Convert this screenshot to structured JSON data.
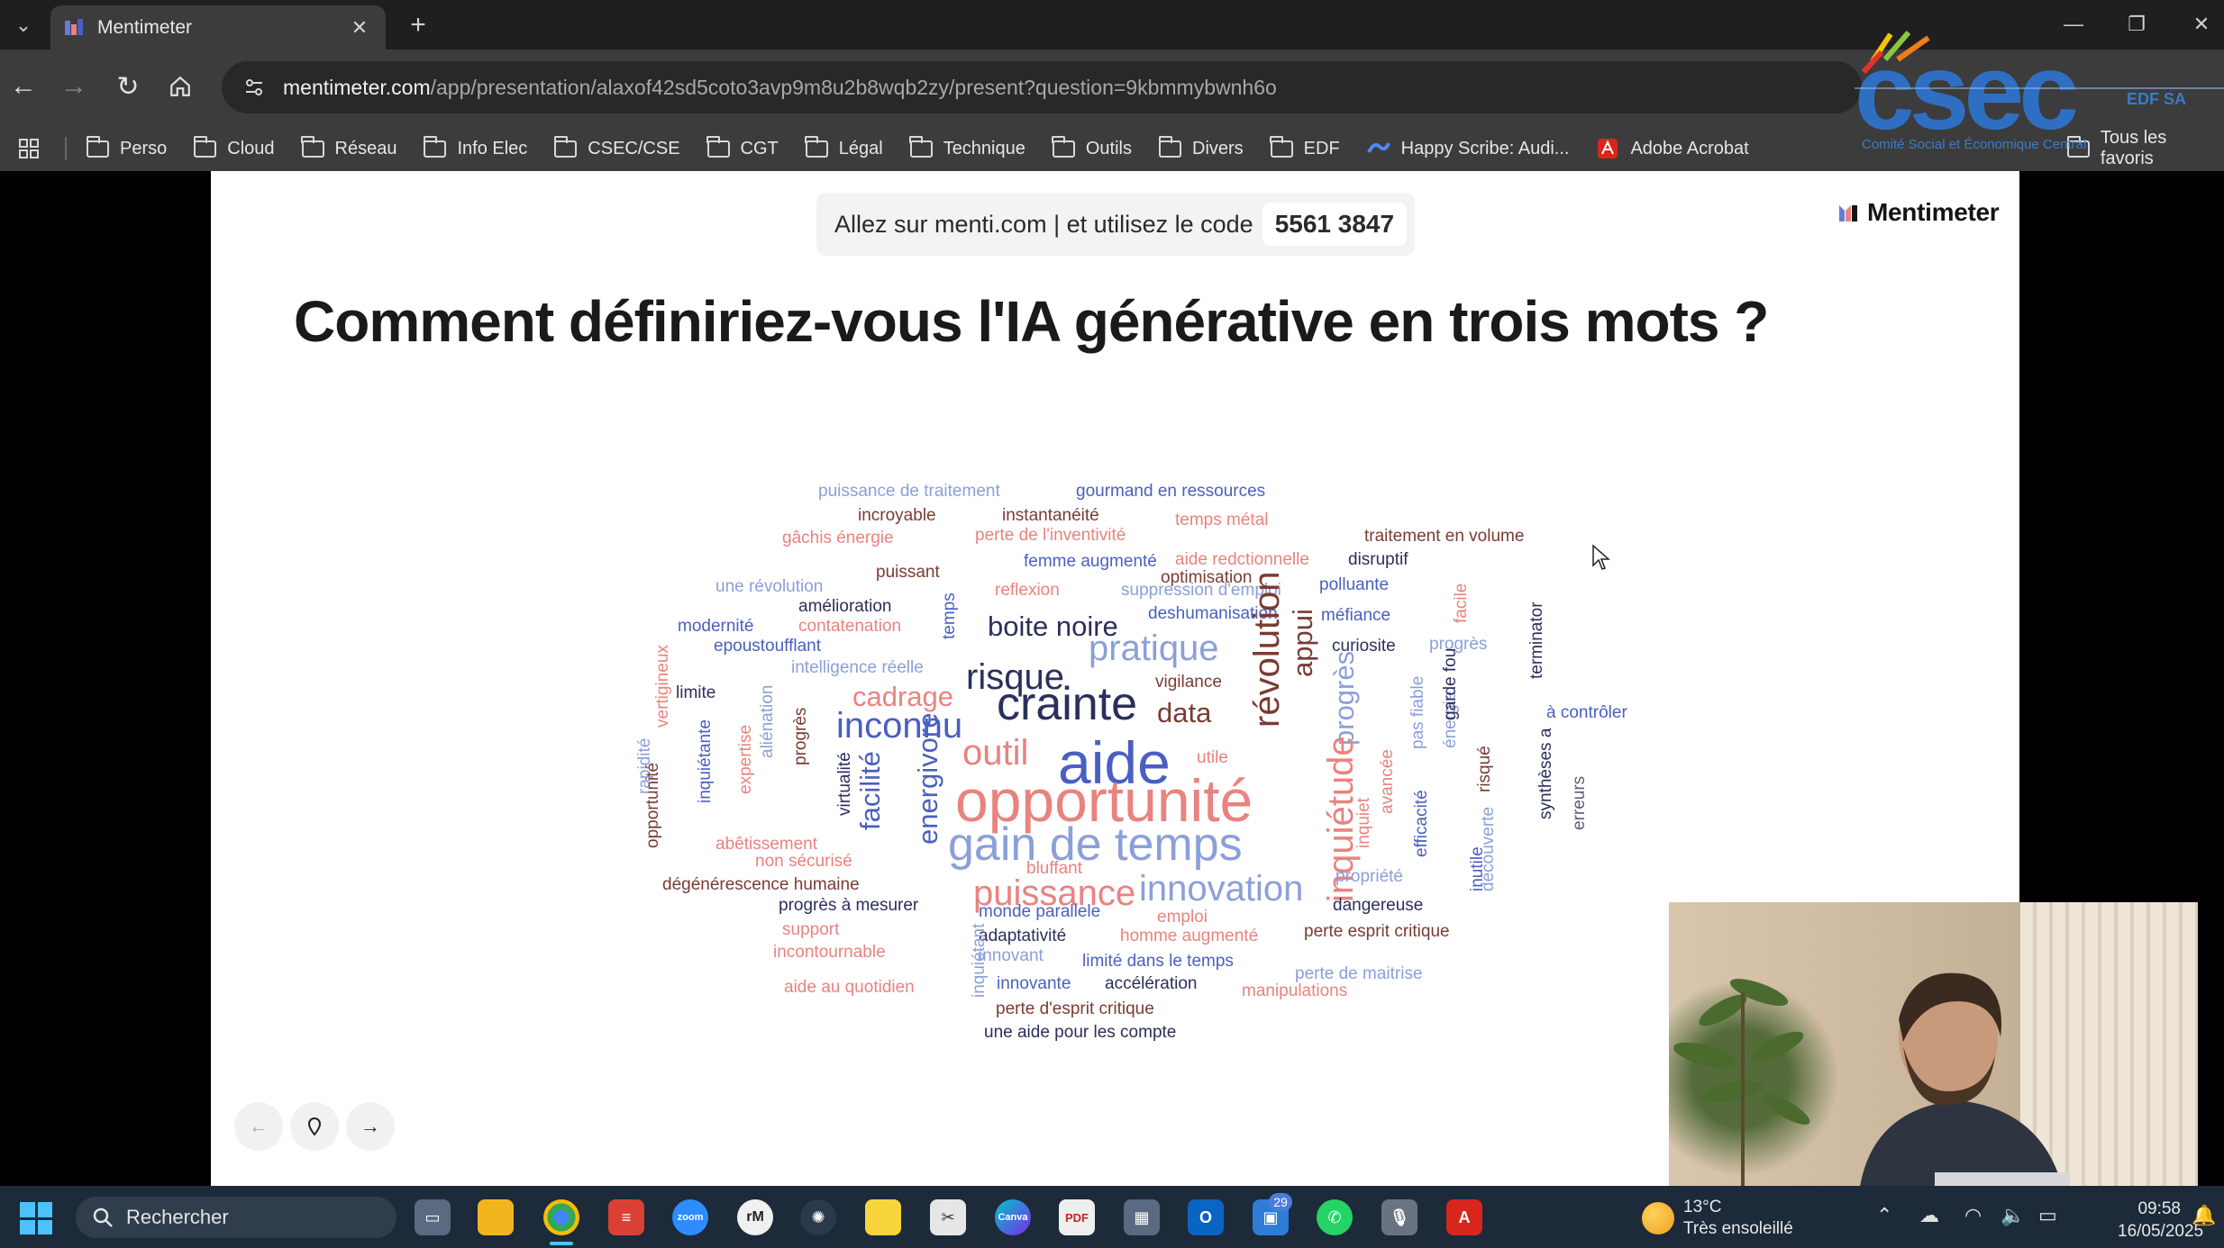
{
  "browser": {
    "tab_title": "Mentimeter",
    "url_host": "mentimeter.com",
    "url_path": "/app/presentation/alaxof42sd5coto3avp9m8u2b8wqb2zy/present?question=9kbmmybwnh6o",
    "bookmarks": [
      "Perso",
      "Cloud",
      "Réseau",
      "Info Elec",
      "CSEC/CSE",
      "CGT",
      "Légal",
      "Technique",
      "Outils",
      "Divers",
      "EDF"
    ],
    "bookmark_happyscribe": "Happy Scribe: Audi...",
    "bookmark_acrobat": "Adobe Acrobat",
    "all_bookmarks": "Tous les favoris"
  },
  "overlay": {
    "csec_tagline": "Comité Social et Économique Central",
    "edf_sa": "EDF SA"
  },
  "slide": {
    "join_text": "Allez sur menti.com | et utilisez le code",
    "code": "5561 3847",
    "brand": "Mentimeter",
    "question": "Comment définiriez-vous l'IA générative en trois mots ?"
  },
  "wordcloud": {
    "colors": {
      "blue": "#4a5fc1",
      "dark": "#2b2f5b",
      "salmon": "#e9837f",
      "light_blue": "#8b9fd9",
      "brown": "#7a3b34",
      "gray": "#5a6074"
    },
    "words": [
      {
        "text": "puissance de traitement",
        "weight": 1,
        "color": "light_blue"
      },
      {
        "text": "gourmand en ressources",
        "weight": 1,
        "color": "blue"
      },
      {
        "text": "incroyable",
        "weight": 1,
        "color": "brown"
      },
      {
        "text": "instantanéité",
        "weight": 1,
        "color": "brown"
      },
      {
        "text": "temps métal",
        "weight": 1,
        "color": "salmon"
      },
      {
        "text": "gâchis énergie",
        "weight": 1,
        "color": "salmon"
      },
      {
        "text": "perte de l'inventivité",
        "weight": 1,
        "color": "salmon"
      },
      {
        "text": "traitement en volume",
        "weight": 1,
        "color": "brown"
      },
      {
        "text": "aide redctionnelle",
        "weight": 1,
        "color": "salmon"
      },
      {
        "text": "femme augmenté",
        "weight": 1,
        "color": "blue"
      },
      {
        "text": "disruptif",
        "weight": 1,
        "color": "dark"
      },
      {
        "text": "puissant",
        "weight": 1,
        "color": "brown"
      },
      {
        "text": "optimisation",
        "weight": 1,
        "color": "brown"
      },
      {
        "text": "une révolution",
        "weight": 1,
        "color": "light_blue"
      },
      {
        "text": "reflexion",
        "weight": 1,
        "color": "salmon"
      },
      {
        "text": "suppression d'emploi",
        "weight": 1,
        "color": "light_blue"
      },
      {
        "text": "polluante",
        "weight": 1,
        "color": "blue"
      },
      {
        "text": "amélioration",
        "weight": 1,
        "color": "dark"
      },
      {
        "text": "facile",
        "weight": 1,
        "color": "salmon"
      },
      {
        "text": "deshumanisation",
        "weight": 1,
        "color": "blue"
      },
      {
        "text": "méfiance",
        "weight": 1,
        "color": "blue"
      },
      {
        "text": "modernité",
        "weight": 1,
        "color": "blue"
      },
      {
        "text": "contatenation",
        "weight": 1,
        "color": "salmon"
      },
      {
        "text": "temps",
        "weight": 1,
        "color": "blue"
      },
      {
        "text": "boite noire",
        "weight": 2,
        "color": "dark"
      },
      {
        "text": "terminator",
        "weight": 1,
        "color": "dark"
      },
      {
        "text": "epoustoufflant",
        "weight": 1,
        "color": "blue"
      },
      {
        "text": "pratique",
        "weight": 3,
        "color": "light_blue"
      },
      {
        "text": "curiosite",
        "weight": 1,
        "color": "dark"
      },
      {
        "text": "progrès",
        "weight": 1,
        "color": "light_blue"
      },
      {
        "text": "intelligence réelle",
        "weight": 1,
        "color": "light_blue"
      },
      {
        "text": "risque",
        "weight": 3,
        "color": "dark"
      },
      {
        "text": "appui",
        "weight": 2,
        "color": "brown"
      },
      {
        "text": "vigilance",
        "weight": 1,
        "color": "brown"
      },
      {
        "text": "limite",
        "weight": 1,
        "color": "dark"
      },
      {
        "text": "cadrage",
        "weight": 2,
        "color": "salmon"
      },
      {
        "text": "crainte",
        "weight": 4,
        "color": "dark"
      },
      {
        "text": "vertigineux",
        "weight": 1,
        "color": "salmon"
      },
      {
        "text": "à contrôler",
        "weight": 1,
        "color": "blue"
      },
      {
        "text": "data",
        "weight": 2,
        "color": "brown"
      },
      {
        "text": "inconnu",
        "weight": 3,
        "color": "blue"
      },
      {
        "text": "révolution",
        "weight": 3,
        "color": "brown"
      },
      {
        "text": "aliénation",
        "weight": 1,
        "color": "light_blue"
      },
      {
        "text": "progrès",
        "weight": 1,
        "color": "brown"
      },
      {
        "text": "progrès",
        "weight": 2,
        "color": "light_blue"
      },
      {
        "text": "pas fiable",
        "weight": 1,
        "color": "light_blue"
      },
      {
        "text": "énergie",
        "weight": 1,
        "color": "light_blue"
      },
      {
        "text": "garde fou",
        "weight": 1,
        "color": "dark"
      },
      {
        "text": "outil",
        "weight": 3,
        "color": "salmon"
      },
      {
        "text": "aide",
        "weight": 5,
        "color": "blue"
      },
      {
        "text": "utile",
        "weight": 1,
        "color": "salmon"
      },
      {
        "text": "expertise",
        "weight": 1,
        "color": "salmon"
      },
      {
        "text": "inquiétante",
        "weight": 1,
        "color": "blue"
      },
      {
        "text": "rapidité",
        "weight": 1,
        "color": "light_blue"
      },
      {
        "text": "virtualité",
        "weight": 1,
        "color": "dark"
      },
      {
        "text": "facilité",
        "weight": 2,
        "color": "blue"
      },
      {
        "text": "energivore",
        "weight": 2,
        "color": "blue"
      },
      {
        "text": "risqué",
        "weight": 1,
        "color": "brown"
      },
      {
        "text": "synthèses a",
        "weight": 1,
        "color": "dark"
      },
      {
        "text": "avancée",
        "weight": 1,
        "color": "salmon"
      },
      {
        "text": "opportunité",
        "weight": 5,
        "color": "salmon"
      },
      {
        "text": "inquiétude",
        "weight": 3,
        "color": "salmon"
      },
      {
        "text": "opportunité",
        "weight": 1,
        "color": "brown"
      },
      {
        "text": "erreurs",
        "weight": 1,
        "color": "gray"
      },
      {
        "text": "efficacité",
        "weight": 1,
        "color": "blue"
      },
      {
        "text": "inquiet",
        "weight": 1,
        "color": "salmon"
      },
      {
        "text": "abêtissement",
        "weight": 1,
        "color": "salmon"
      },
      {
        "text": "gain de temps",
        "weight": 4,
        "color": "light_blue"
      },
      {
        "text": "découverte",
        "weight": 1,
        "color": "light_blue"
      },
      {
        "text": "non sécurisé",
        "weight": 1,
        "color": "salmon"
      },
      {
        "text": "bluffant",
        "weight": 1,
        "color": "salmon"
      },
      {
        "text": "propriété",
        "weight": 1,
        "color": "light_blue"
      },
      {
        "text": "inutile",
        "weight": 1,
        "color": "blue"
      },
      {
        "text": "dégénérescence humaine",
        "weight": 1,
        "color": "brown"
      },
      {
        "text": "puissance",
        "weight": 3,
        "color": "salmon"
      },
      {
        "text": "innovation",
        "weight": 3,
        "color": "light_blue"
      },
      {
        "text": "dangereuse",
        "weight": 1,
        "color": "dark"
      },
      {
        "text": "progrès à mesurer",
        "weight": 1,
        "color": "dark"
      },
      {
        "text": "monde parallele",
        "weight": 1,
        "color": "blue"
      },
      {
        "text": "emploi",
        "weight": 1,
        "color": "salmon"
      },
      {
        "text": "perte esprit critique",
        "weight": 1,
        "color": "brown"
      },
      {
        "text": "support",
        "weight": 1,
        "color": "salmon"
      },
      {
        "text": "adaptativité",
        "weight": 1,
        "color": "dark"
      },
      {
        "text": "homme augmenté",
        "weight": 1,
        "color": "salmon"
      },
      {
        "text": "incontournable",
        "weight": 1,
        "color": "salmon"
      },
      {
        "text": "inquiétant",
        "weight": 1,
        "color": "light_blue"
      },
      {
        "text": "innovant",
        "weight": 1,
        "color": "light_blue"
      },
      {
        "text": "limité dans le temps",
        "weight": 1,
        "color": "blue"
      },
      {
        "text": "perte de maitrise",
        "weight": 1,
        "color": "light_blue"
      },
      {
        "text": "innovante",
        "weight": 1,
        "color": "blue"
      },
      {
        "text": "accélération",
        "weight": 1,
        "color": "dark"
      },
      {
        "text": "aide au quotidien",
        "weight": 1,
        "color": "salmon"
      },
      {
        "text": "manipulations",
        "weight": 1,
        "color": "salmon"
      },
      {
        "text": "perte d'esprit critique",
        "weight": 1,
        "color": "brown"
      },
      {
        "text": "une aide pour les compte",
        "weight": 1,
        "color": "dark"
      }
    ]
  },
  "taskbar": {
    "search_placeholder": "Rechercher",
    "outlook_badge": "29",
    "weather_temp": "13°C",
    "weather_desc": "Très ensoleillé",
    "time": "09:58",
    "date": "16/05/2025"
  }
}
